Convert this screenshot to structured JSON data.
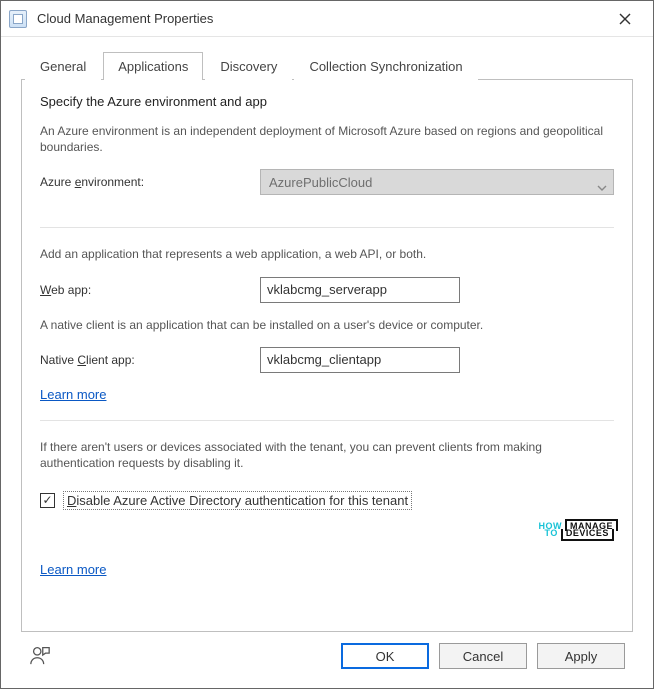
{
  "window": {
    "title": "Cloud Management Properties"
  },
  "tabs": {
    "general": "General",
    "applications": "Applications",
    "discovery": "Discovery",
    "collection_sync": "Collection Synchronization",
    "active": "applications"
  },
  "section1": {
    "headline": "Specify the Azure environment and app",
    "desc": "An Azure environment is an independent deployment of Microsoft Azure based on regions and geopolitical boundaries.",
    "env_label_pre": "Azure ",
    "env_label_u": "e",
    "env_label_post": "nvironment:",
    "env_value": "AzurePublicCloud"
  },
  "section2": {
    "desc": "Add an application that represents a web application, a web API, or both.",
    "web_label_u": "W",
    "web_label_post": "eb app:",
    "web_value": "vklabcmg_serverapp",
    "native_desc": "A native client is an application that can be installed on a user's device or computer.",
    "native_label_pre": "Native ",
    "native_label_u": "C",
    "native_label_post": "lient app:",
    "native_value": "vklabcmg_clientapp",
    "learn_more": "Learn more"
  },
  "section3": {
    "desc": "If there aren't users or devices associated with the tenant, you can prevent clients from making authentication requests by disabling it.",
    "checkbox_label_u": "D",
    "checkbox_label_post": "isable Azure Active Directory authentication for this tenant",
    "checked": true,
    "learn_more": "Learn more"
  },
  "buttons": {
    "ok": "OK",
    "cancel": "Cancel",
    "apply": "Apply"
  },
  "logo": {
    "how": "HOW",
    "manage": "MANAGE",
    "to": "TO",
    "devices": "DEVICES"
  }
}
